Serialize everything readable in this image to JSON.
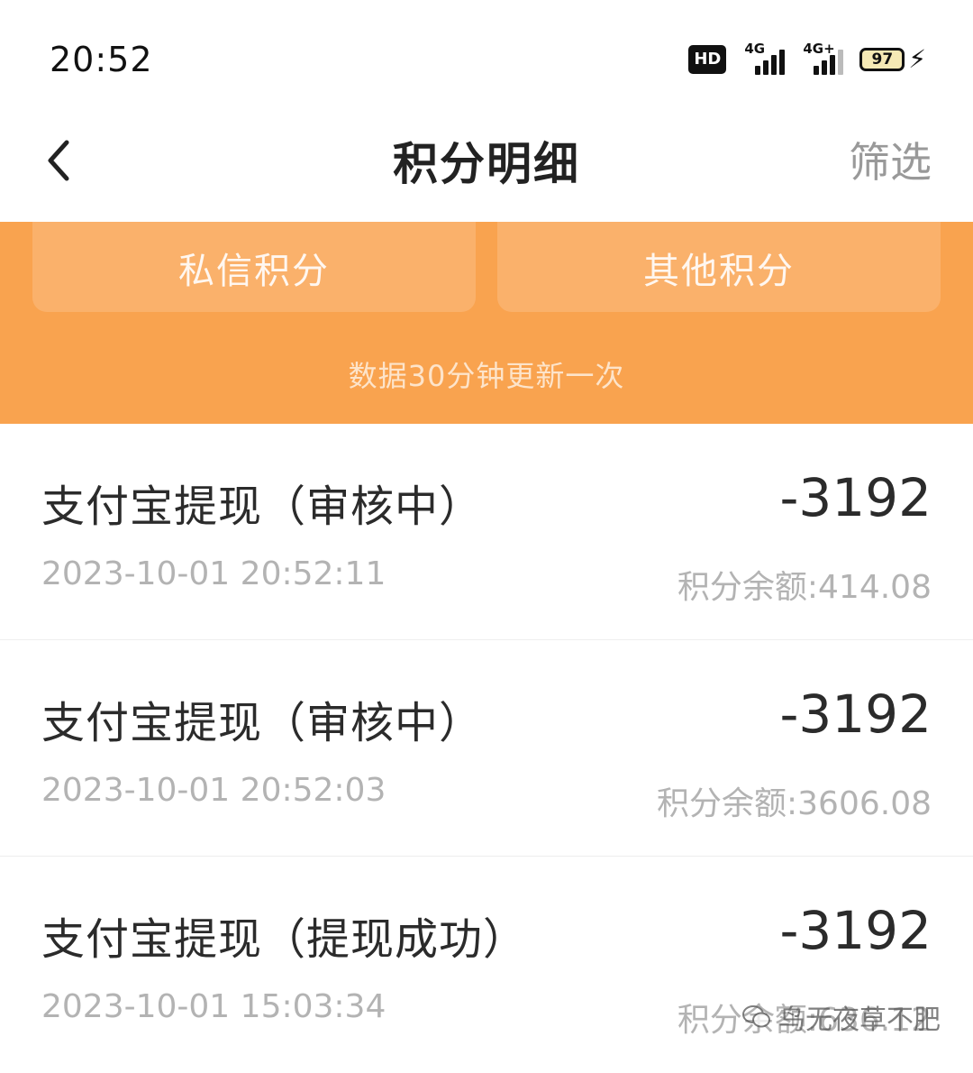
{
  "status_bar": {
    "time": "20:52",
    "hd_badge": "HD",
    "network1": "4G",
    "network2": "4G+",
    "battery": "97"
  },
  "header": {
    "title": "积分明细",
    "filter_label": "筛选"
  },
  "summary": {
    "cards": [
      {
        "label": "私信积分"
      },
      {
        "label": "其他积分"
      }
    ],
    "update_note": "数据30分钟更新一次"
  },
  "records": [
    {
      "title": "支付宝提现（审核中）",
      "amount": "-3192",
      "time": "2023-10-01 20:52:11",
      "balance": "积分余额:414.08"
    },
    {
      "title": "支付宝提现（审核中）",
      "amount": "-3192",
      "time": "2023-10-01 20:52:03",
      "balance": "积分余额:3606.08"
    },
    {
      "title": "支付宝提现（提现成功）",
      "amount": "-3192",
      "time": "2023-10-01 15:03:34",
      "balance": "积分余额:636.12"
    }
  ],
  "watermark": "鸟无夜草不肥",
  "colors": {
    "accent_orange": "#f9a34f",
    "muted_text": "#b3b3b3"
  }
}
